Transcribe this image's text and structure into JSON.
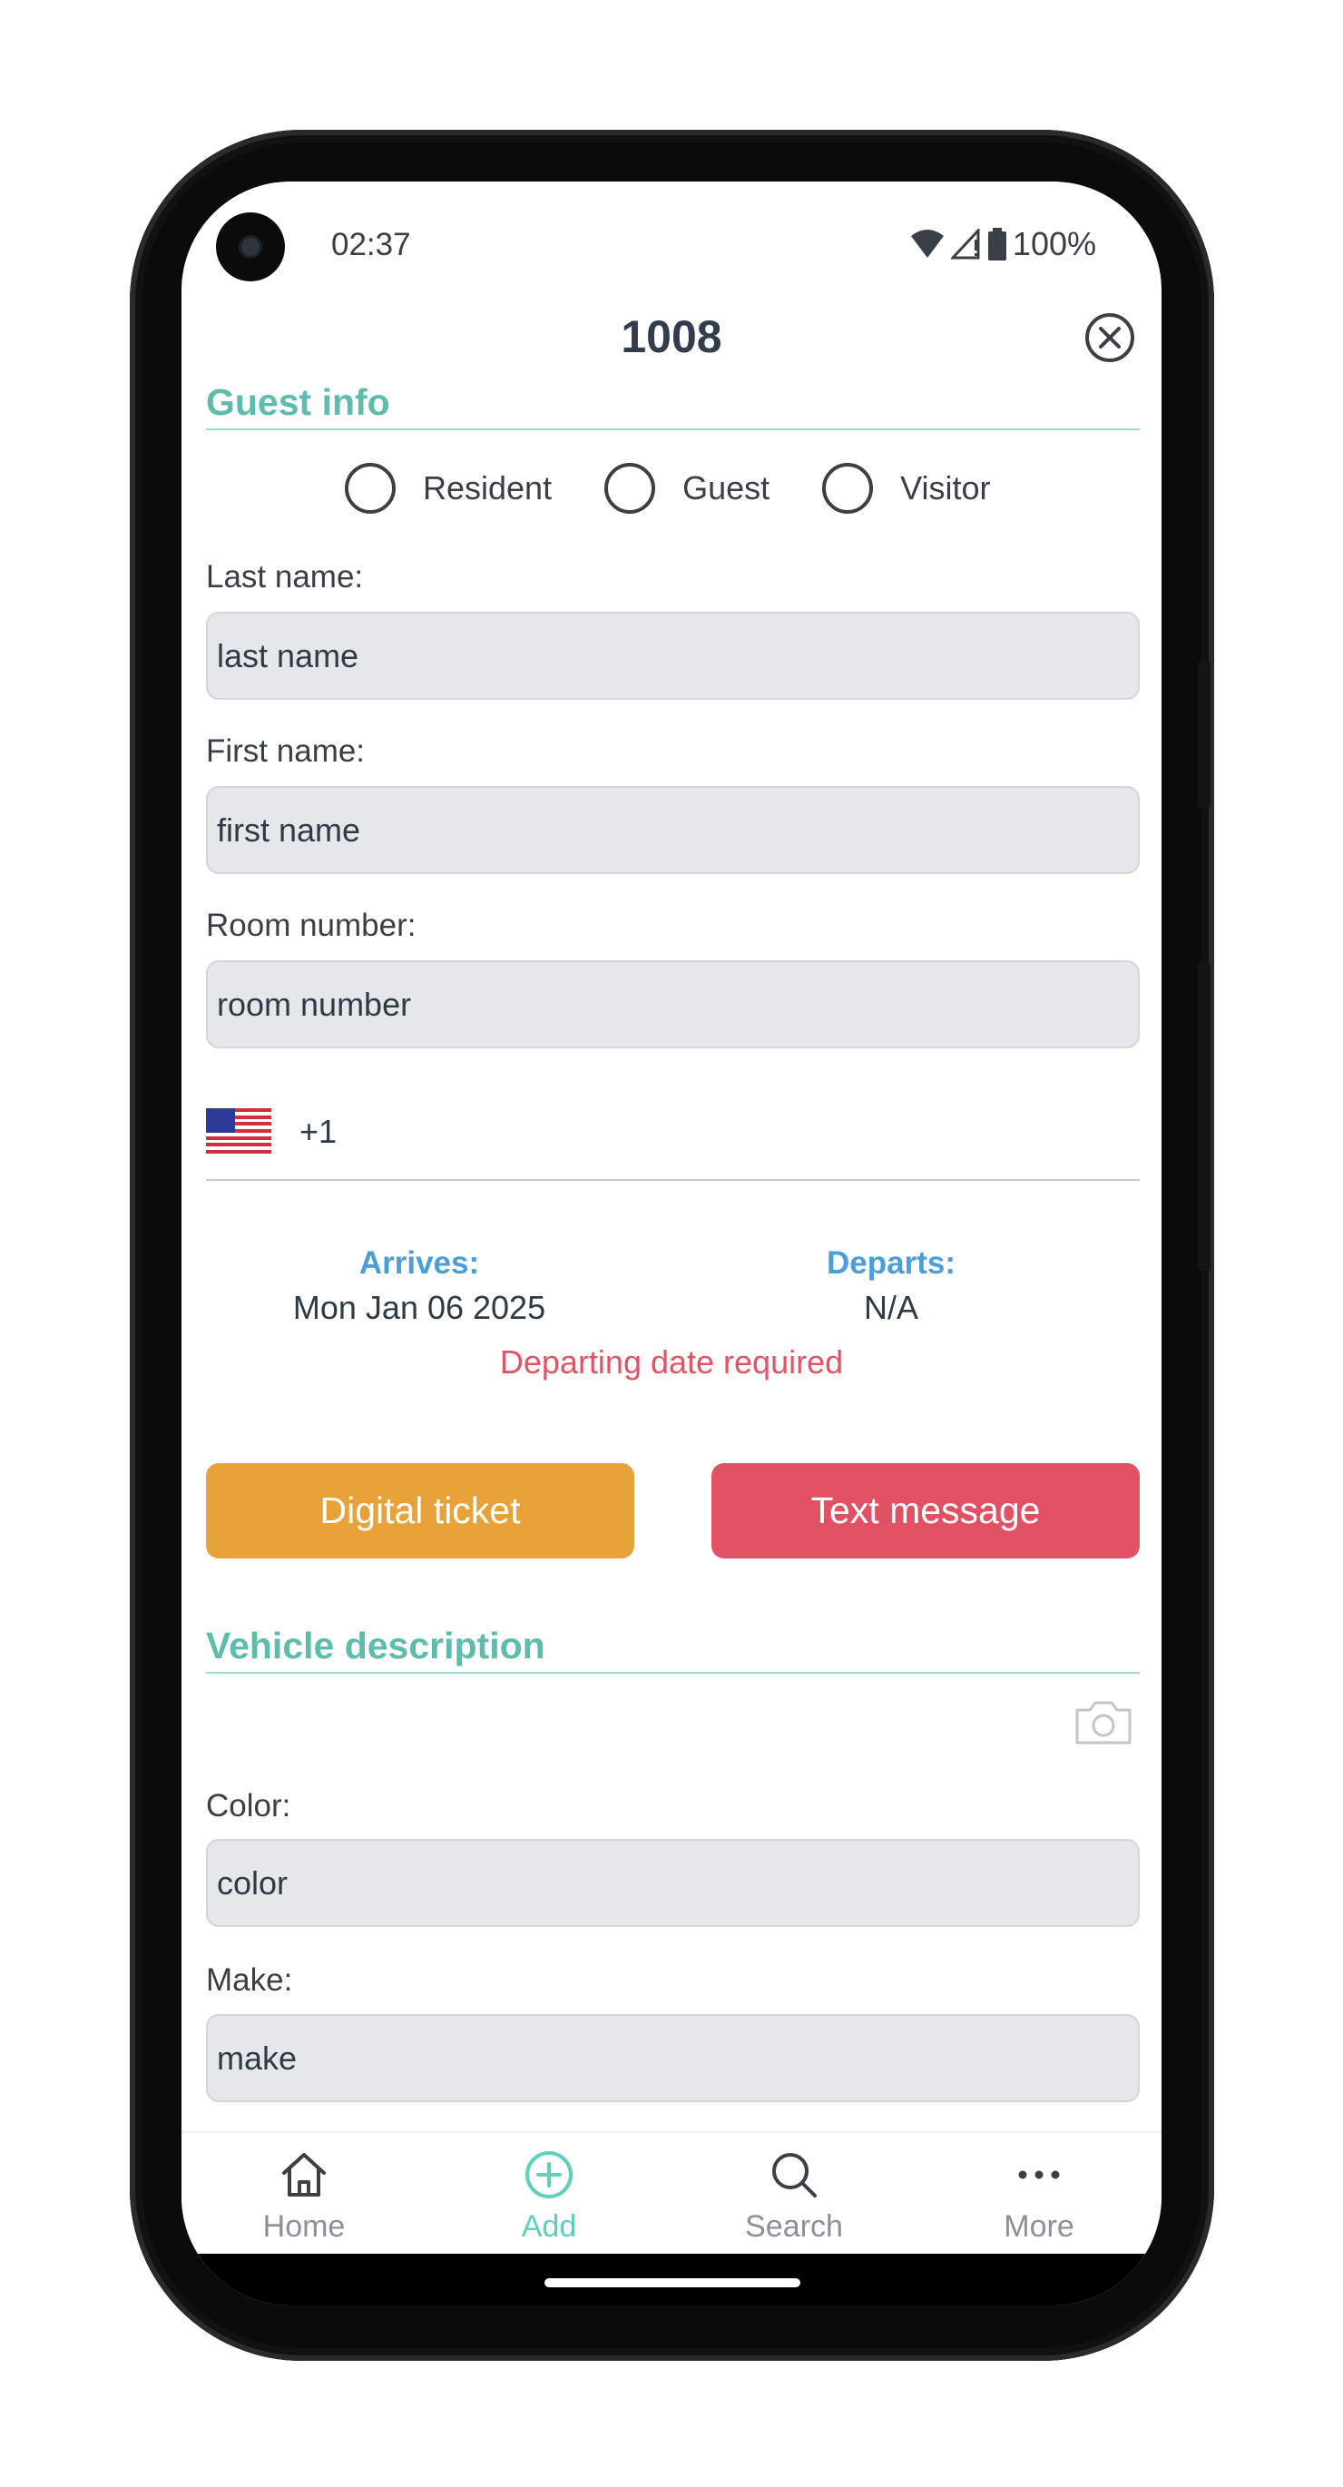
{
  "status_bar": {
    "time": "02:37",
    "battery": "100%"
  },
  "header": {
    "title": "1008"
  },
  "guest_info": {
    "section_title": "Guest info",
    "radio_options": [
      "Resident",
      "Guest",
      "Visitor"
    ],
    "last_name": {
      "label": "Last name:",
      "placeholder": "last name"
    },
    "first_name": {
      "label": "First name:",
      "placeholder": "first name"
    },
    "room_number": {
      "label": "Room number:",
      "placeholder": "room number"
    },
    "phone": {
      "country_code": "+1",
      "flag": "us-flag-icon"
    },
    "arrives": {
      "label": "Arrives:",
      "value": "Mon Jan 06 2025"
    },
    "departs": {
      "label": "Departs:",
      "value": "N/A"
    },
    "error": "Departing date required"
  },
  "actions": {
    "digital_ticket": "Digital ticket",
    "text_message": "Text message",
    "digital_ticket_color": "#e8a23a",
    "text_message_color": "#e05164"
  },
  "vehicle": {
    "section_title": "Vehicle description",
    "color": {
      "label": "Color:",
      "placeholder": "color"
    },
    "make": {
      "label": "Make:",
      "placeholder": "make"
    }
  },
  "bottom_nav": [
    {
      "label": "Home",
      "icon": "home-icon",
      "active": false
    },
    {
      "label": "Add",
      "icon": "add-circle-icon",
      "active": true
    },
    {
      "label": "Search",
      "icon": "search-icon",
      "active": false
    },
    {
      "label": "More",
      "icon": "more-dots-icon",
      "active": false
    }
  ],
  "colors": {
    "accent": "#5dbcab",
    "link_blue": "#4a9fd8",
    "error": "#e35366"
  }
}
